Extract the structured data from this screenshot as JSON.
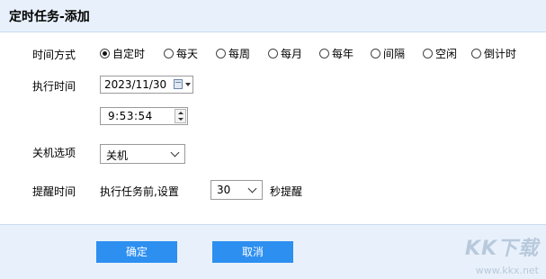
{
  "dialog": {
    "title": "定时任务-添加"
  },
  "schedule_mode": {
    "label": "时间方式",
    "options": [
      "自定时",
      "每天",
      "每周",
      "每月",
      "每年",
      "间隔",
      "空闲",
      "倒计时"
    ],
    "selected": "自定时"
  },
  "exec_time": {
    "label": "执行时间",
    "date": "2023/11/30",
    "time": "9:53:54"
  },
  "shutdown": {
    "label": "关机选项",
    "value": "关机"
  },
  "reminder": {
    "label": "提醒时间",
    "prefix": "执行任务前,设置",
    "seconds": "30",
    "suffix": "秒提醒"
  },
  "buttons": {
    "ok": "确定",
    "cancel": "取消"
  },
  "watermark": {
    "text": "KK下载",
    "url": "www.kkx.net"
  },
  "colors": {
    "accent": "#2d8ff0",
    "header_bg": "#e8f1fb"
  }
}
